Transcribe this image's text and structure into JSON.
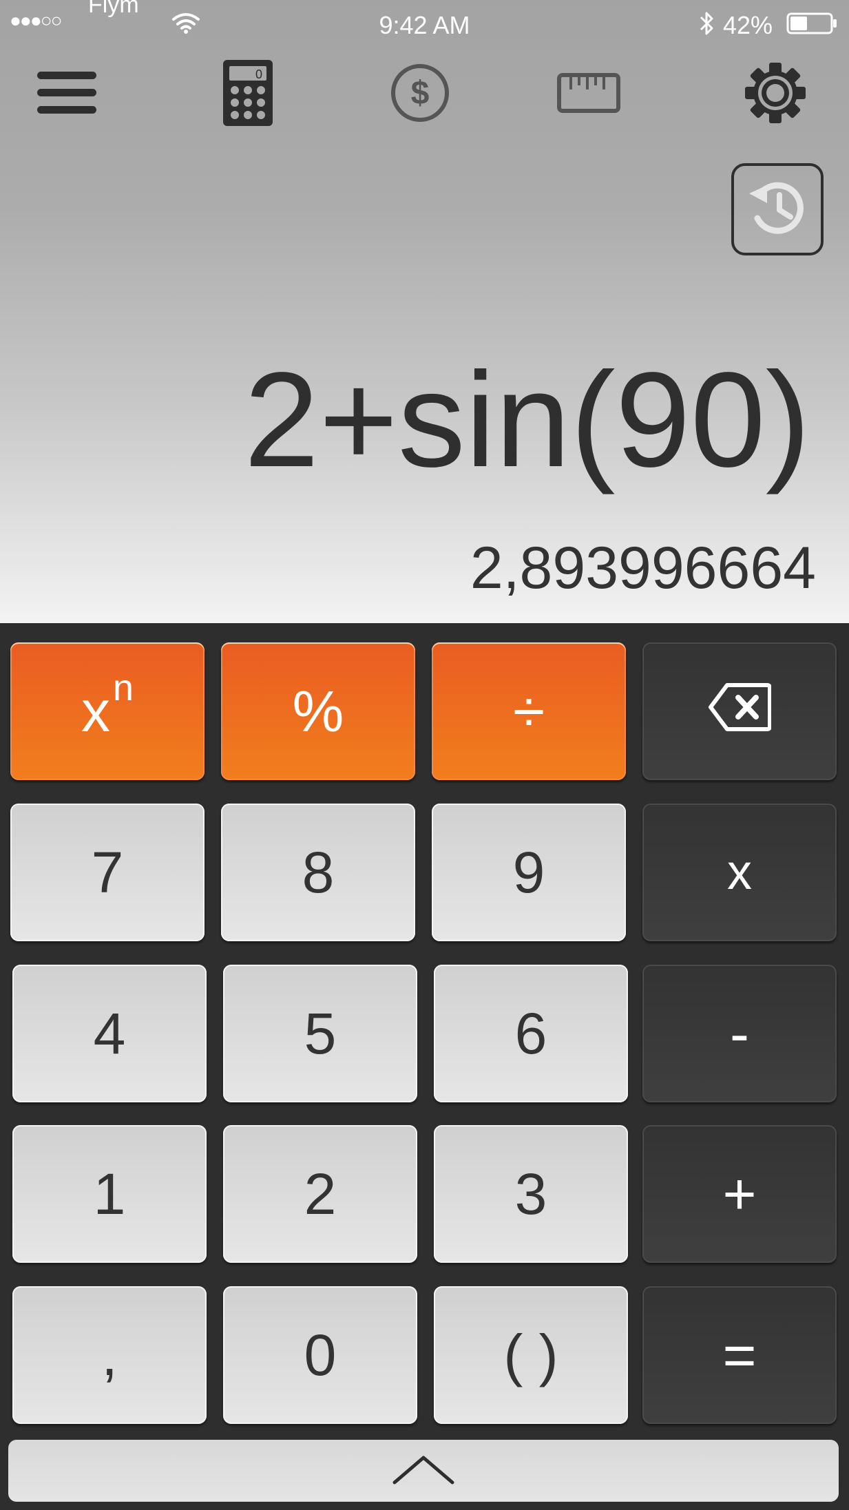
{
  "status_bar": {
    "signal": "●●●○○",
    "carrier": "Flym",
    "time": "9:42 AM",
    "battery": "42%",
    "icons": [
      "wifi-icon",
      "bluetooth-icon",
      "battery-icon"
    ]
  },
  "toolbar": {
    "items": [
      "menu-icon",
      "calculator-icon",
      "currency-icon",
      "ruler-icon",
      "gear-icon"
    ]
  },
  "history": {
    "icon": "history-icon"
  },
  "display": {
    "expression": "2+sin(90)",
    "result": "2,893996664"
  },
  "keypad": {
    "rows": [
      [
        "x",
        "%",
        "÷",
        "backspace"
      ],
      [
        "7",
        "8",
        "9",
        "x"
      ],
      [
        "4",
        "5",
        "6",
        "-"
      ],
      [
        "1",
        "2",
        "3",
        "+"
      ],
      [
        ",",
        "0",
        "( )",
        "="
      ]
    ],
    "power_base": "x",
    "power_exp": "n",
    "percent": "%",
    "divide": "÷",
    "multiply": "x",
    "minus": "-",
    "plus": "+",
    "equals": "=",
    "comma": ",",
    "parens": "( )",
    "digits": {
      "d0": "0",
      "d1": "1",
      "d2": "2",
      "d3": "3",
      "d4": "4",
      "d5": "5",
      "d6": "6",
      "d7": "7",
      "d8": "8",
      "d9": "9"
    }
  },
  "colors": {
    "operator_accent": "#f27e1d",
    "dark_key": "#383838",
    "light_key": "#dcdcdc",
    "text_dark": "#2f2f2f"
  },
  "expand": {
    "icon": "chevron-up-icon"
  }
}
